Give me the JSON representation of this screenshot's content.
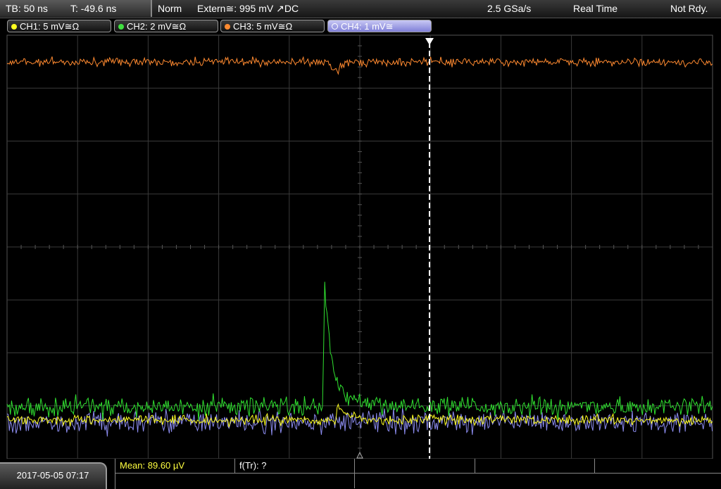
{
  "status_bar": {
    "timebase": "TB: 50 ns",
    "trigger_time": "T: -49.6 ns",
    "trigger_mode": "Norm",
    "trigger_source": "Extern≅: 995 mV ↗DC",
    "sample_rate": "2.5 GSa/s",
    "acq_mode": "Real Time",
    "trigger_status": "Not Rdy."
  },
  "channels": [
    {
      "label": "CH1: 5 mV≅Ω",
      "color": "#ffff20",
      "active": false
    },
    {
      "label": "CH2: 2 mV≅Ω",
      "color": "#40e040",
      "active": false
    },
    {
      "label": "CH3: 5 mV≅Ω",
      "color": "#ff8a30",
      "active": false
    },
    {
      "label": "CH4: 1 mV≅",
      "color": "#8c8cf0",
      "active": true
    }
  ],
  "measurements": {
    "mean": "Mean: 89.60 µV",
    "ftr": "f(Tr): ?"
  },
  "datetime": "2017-05-05 07:17",
  "colors": {
    "ch1": "#ffff20",
    "ch2": "#30e030",
    "ch3": "#ff8a30",
    "ch4": "#8c8cf0",
    "grid": "#3a3a3a",
    "mean_text": "#ffff40"
  }
}
